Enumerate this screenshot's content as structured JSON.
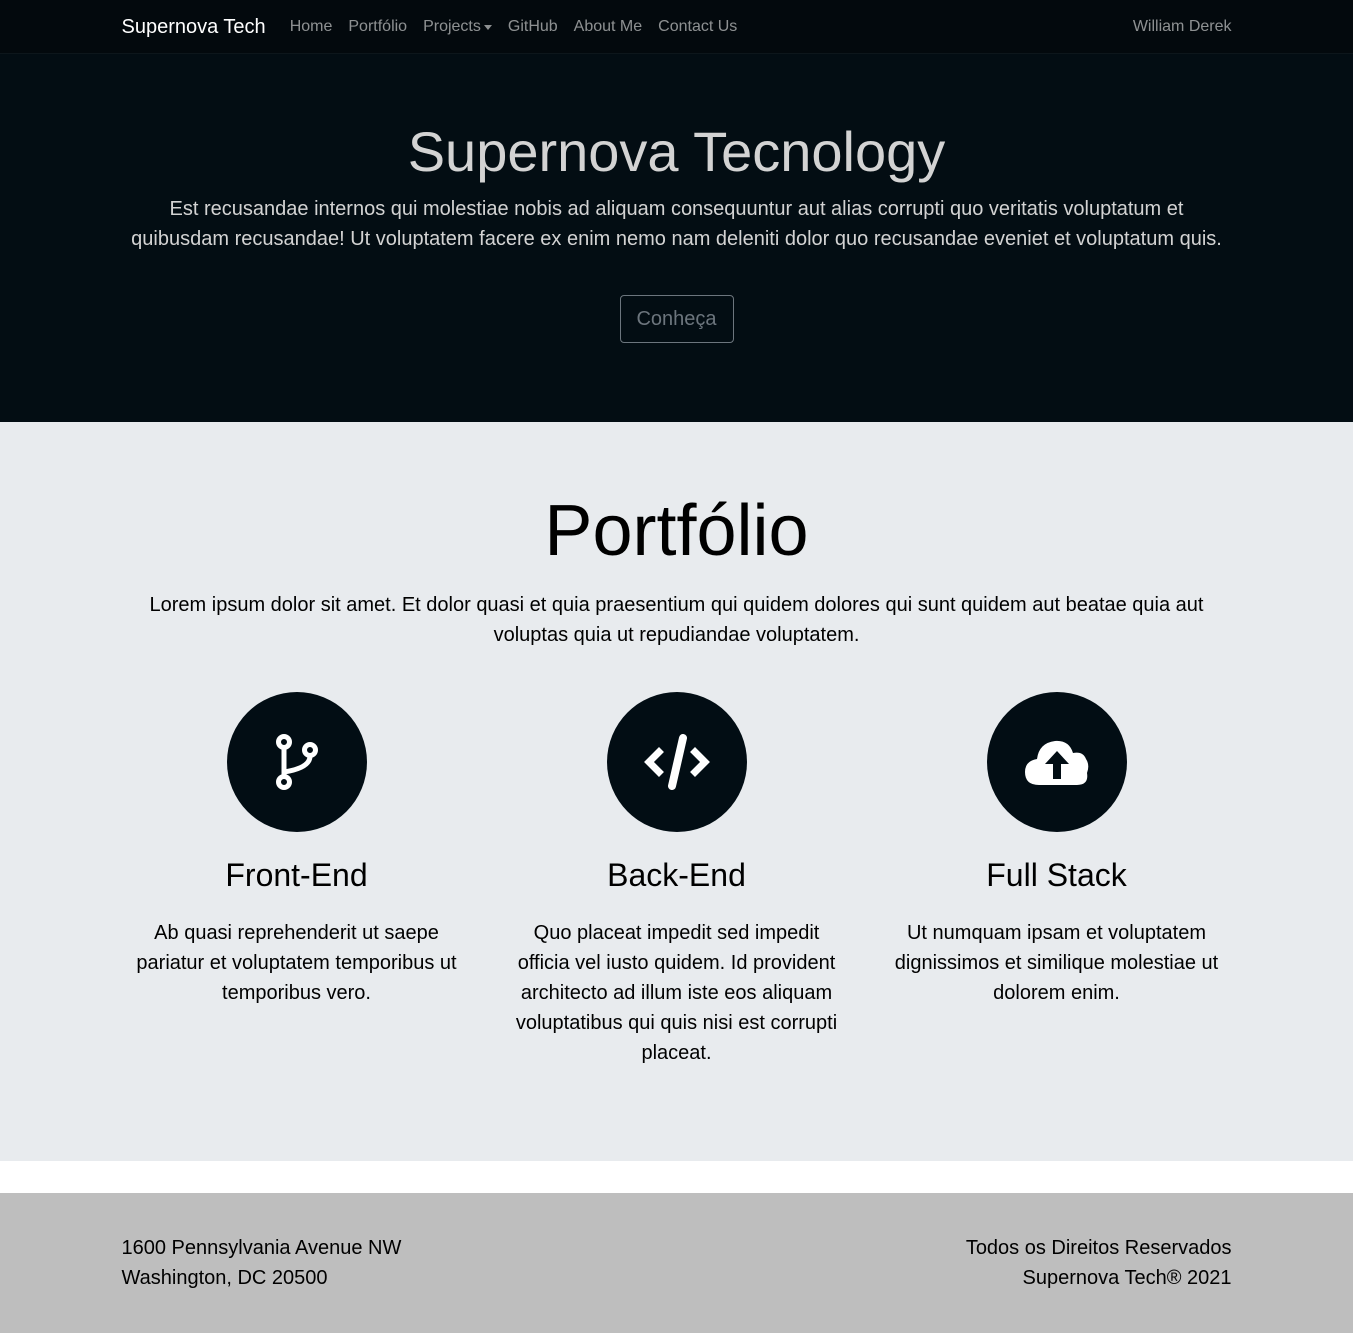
{
  "navbar": {
    "brand": "Supernova Tech",
    "links": [
      "Home",
      "Portfólio",
      "Projects",
      "GitHub",
      "About Me",
      "Contact Us"
    ],
    "user": "William Derek"
  },
  "hero": {
    "title": "Supernova Tecnology",
    "text": "Est recusandae internos qui molestiae nobis ad aliquam consequuntur aut alias corrupti quo veritatis voluptatum et quibusdam recusandae! Ut voluptatem facere ex enim nemo nam deleniti dolor quo recusandae eveniet et voluptatum quis.",
    "button_label": "Conheça"
  },
  "portfolio": {
    "title": "Portfólio",
    "text": "Lorem ipsum dolor sit amet. Et dolor quasi et quia praesentium qui quidem dolores qui sunt quidem aut beatae quia aut voluptas quia ut repudiandae voluptatem.",
    "features": [
      {
        "icon": "code-branch-icon",
        "title": "Front-End",
        "text": "Ab quasi reprehenderit ut saepe pariatur et voluptatem temporibus ut temporibus vero."
      },
      {
        "icon": "code-icon",
        "title": "Back-End",
        "text": "Quo placeat impedit sed impedit officia vel iusto quidem. Id provident architecto ad illum iste eos aliquam voluptatibus qui quis nisi est corrupti placeat."
      },
      {
        "icon": "cloud-upload-icon",
        "title": "Full Stack",
        "text": "Ut numquam ipsam et voluptatem dignissimos et similique molestiae ut dolorem enim."
      }
    ]
  },
  "footer": {
    "address_line1": "1600 Pennsylvania Avenue NW",
    "address_line2": "Washington, DC 20500",
    "rights_line1": "Todos os Direitos Reservados",
    "rights_line2": "Supernova Tech® 2021"
  },
  "colors": {
    "navbar_bg": "#03090d",
    "hero_bg": "#030d13",
    "section_bg": "#e8ebee",
    "footer_bg": "#bebebe",
    "icon_circle": "#020d14"
  }
}
